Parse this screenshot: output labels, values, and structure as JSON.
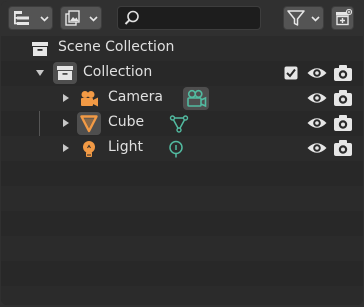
{
  "header": {
    "display_mode": "View Layer",
    "filter_label": "Filter",
    "new_collection_label": "New Collection",
    "search": {
      "value": "",
      "placeholder": ""
    }
  },
  "tree": {
    "scene_collection": {
      "label": "Scene Collection",
      "icon": "scene-collection-icon"
    },
    "collection": {
      "label": "Collection",
      "icon": "collection-icon",
      "expanded": true,
      "exclude_checked": true
    },
    "items": [
      {
        "label": "Camera",
        "icon": "camera-object-icon",
        "data_icon": "camera-data-icon",
        "data_active": true
      },
      {
        "label": "Cube",
        "icon": "mesh-object-icon",
        "data_icon": "mesh-data-icon",
        "data_active": false,
        "object_active": true
      },
      {
        "label": "Light",
        "icon": "light-object-icon",
        "data_icon": "light-data-icon",
        "data_active": false
      }
    ]
  },
  "colors": {
    "background": "#282828",
    "header": "#303030",
    "text": "#e0e0e0",
    "object_icon": "#f29a45",
    "data_icon": "#52bba1",
    "active_highlight": "#4e4e4e"
  }
}
